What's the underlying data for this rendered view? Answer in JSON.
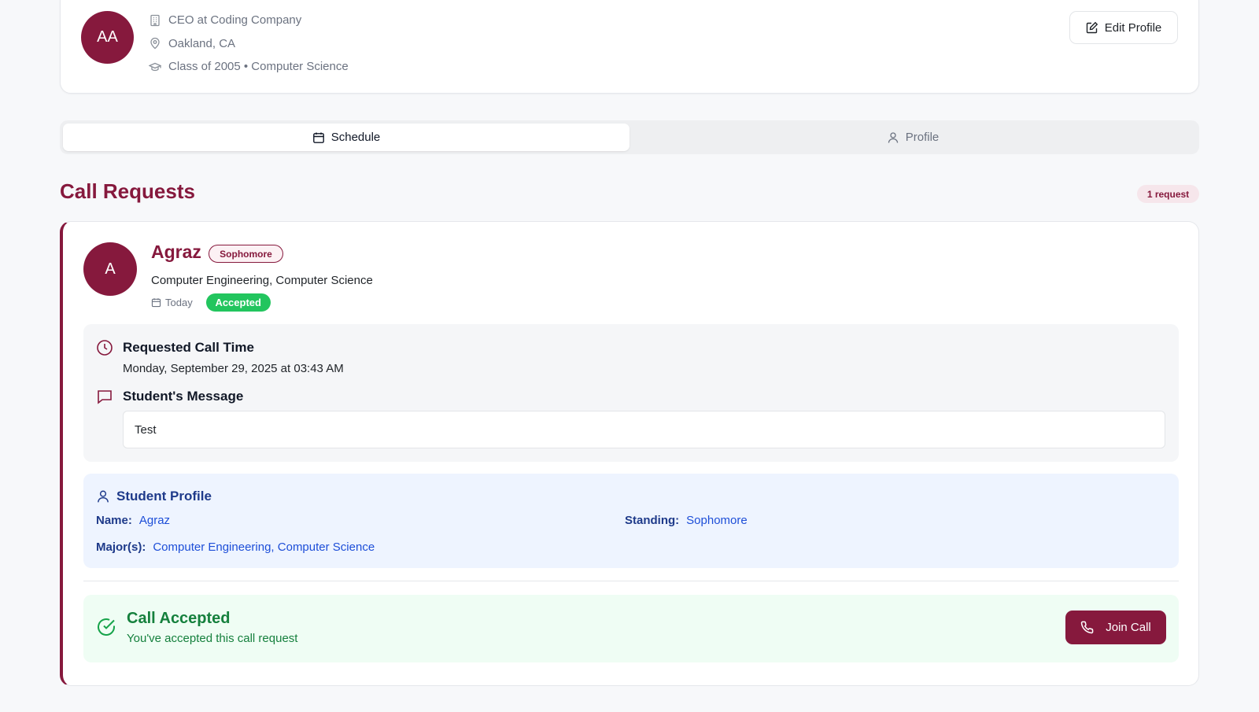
{
  "profile": {
    "initials": "AA",
    "title": "CEO at Coding Company",
    "location": "Oakland, CA",
    "education": "Class of 2005 • Computer Science",
    "edit_label": "Edit Profile"
  },
  "tabs": [
    {
      "label": "Schedule",
      "icon": "calendar-icon",
      "active": true
    },
    {
      "label": "Profile",
      "icon": "user-icon",
      "active": false
    }
  ],
  "section": {
    "title": "Call Requests",
    "count_label": "1 request"
  },
  "request": {
    "avatar_initial": "A",
    "name": "Agraz",
    "standing": "Sophomore",
    "majors": "Computer Engineering, Computer Science",
    "date": "Today",
    "status": "Accepted",
    "time_label": "Requested Call Time",
    "time_value": "Monday, September 29, 2025 at 03:43 AM",
    "message_label": "Student's Message",
    "message": "Test",
    "student_profile": {
      "title": "Student Profile",
      "name_key": "Name:",
      "name_value": "Agraz",
      "standing_key": "Standing:",
      "standing_value": "Sophomore",
      "majors_key": "Major(s):",
      "majors_value": "Computer Engineering, Computer Science"
    },
    "accepted": {
      "title": "Call Accepted",
      "subtitle": "You've accepted this call request",
      "join_label": "Join Call"
    }
  },
  "colors": {
    "brand": "#86193d",
    "success": "#22c55e",
    "info_bg": "#eef4ff",
    "success_bg": "#effdf4"
  }
}
